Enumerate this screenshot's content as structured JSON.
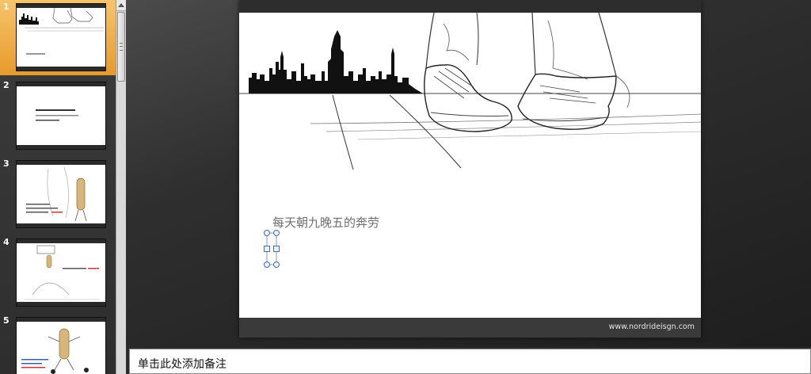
{
  "thumbnails": [
    {
      "number": "1",
      "selected": true
    },
    {
      "number": "2",
      "selected": false
    },
    {
      "number": "3",
      "selected": false
    },
    {
      "number": "4",
      "selected": false
    },
    {
      "number": "5",
      "selected": false
    }
  ],
  "slide": {
    "text": "每天朝九晚五的奔劳",
    "footer_url": "www.nordrideisgn.com"
  },
  "notes": {
    "placeholder": "单击此处添加备注"
  },
  "colors": {
    "selection": "#e79a2c",
    "slide_bar": "#3a3a3a"
  }
}
